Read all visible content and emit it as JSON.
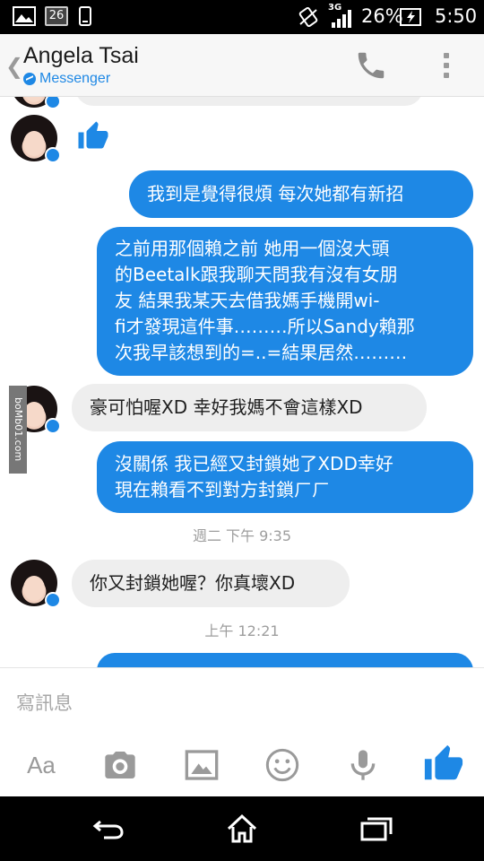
{
  "status_bar": {
    "notification_number": "26",
    "network_type": "3G",
    "battery": "26%",
    "time": "5:50"
  },
  "header": {
    "contact_name": "Angela Tsai",
    "subtitle": "Messenger"
  },
  "messages": [
    {
      "type": "like",
      "direction": "in"
    },
    {
      "type": "text",
      "direction": "out",
      "lines": [
        "我到是覺得很煩 每次她都有新招"
      ]
    },
    {
      "type": "text",
      "direction": "out",
      "lines": [
        "之前用那個賴之前 她用一個沒大頭",
        "的Beetalk跟我聊天問我有沒有女朋",
        "友 結果我某天去借我媽手機開wi-",
        "fi才發現這件事………所以Sandy賴那",
        "次我早該想到的=..=結果居然………"
      ]
    },
    {
      "type": "text",
      "direction": "in",
      "lines": [
        "豪可怕喔XD 幸好我媽不會這樣XD"
      ]
    },
    {
      "type": "text",
      "direction": "out",
      "lines": [
        "沒關係 我已經又封鎖她了XDD幸好",
        "現在賴看不到對方封鎖ㄏㄏ"
      ]
    },
    {
      "type": "timestamp",
      "text": "週二 下午 9:35"
    },
    {
      "type": "text",
      "direction": "in",
      "lines": [
        "你又封鎖她喔？你真壞XD"
      ]
    },
    {
      "type": "timestamp",
      "text": "上午 12:21"
    }
  ],
  "watermark": "boMb01.com",
  "composer": {
    "placeholder": "寫訊息",
    "text_format_label": "Aa"
  },
  "colors": {
    "accent": "#1e88e5",
    "incoming_bubble": "#eeeeee",
    "outgoing_bubble": "#1e88e5"
  },
  "icons": {
    "status": [
      "image-icon",
      "calendar-icon",
      "phone-device-icon",
      "vibrate-icon",
      "signal-icon",
      "battery-charging-icon"
    ],
    "header": [
      "back-chevron-icon",
      "messenger-icon",
      "phone-call-icon",
      "more-vertical-icon"
    ],
    "composer": [
      "text-format-icon",
      "camera-icon",
      "gallery-icon",
      "emoji-icon",
      "microphone-icon",
      "thumbs-up-icon"
    ],
    "nav": [
      "back-nav-icon",
      "home-nav-icon",
      "recents-nav-icon"
    ]
  }
}
